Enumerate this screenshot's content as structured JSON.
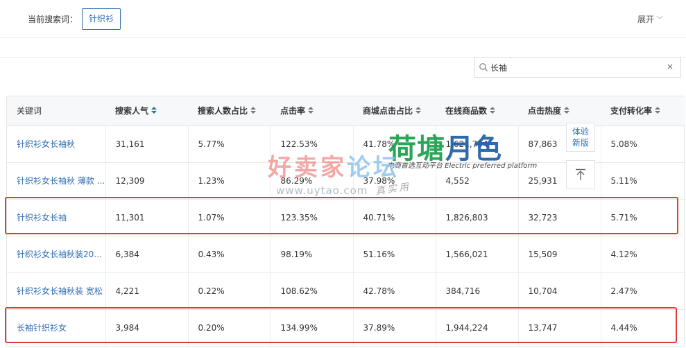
{
  "search": {
    "label": "当前搜索词：",
    "tag": "针织衫",
    "expand_label": "展开"
  },
  "filter": {
    "value": "长袖",
    "clear": "×"
  },
  "table": {
    "headers": [
      "关键词",
      "搜索人气",
      "搜索人数占比",
      "点击率",
      "商城点击占比",
      "在线商品数",
      "点击热度",
      "支付转化率"
    ],
    "sortable": [
      false,
      true,
      true,
      true,
      true,
      true,
      true,
      true
    ],
    "active_sort_index": 1,
    "rows": [
      [
        "针织衫女长袖秋",
        "31,161",
        "5.77%",
        "122.53%",
        "41.78%",
        "1,621,704",
        "87,863",
        "5.08%"
      ],
      [
        "针织衫女长袖秋 薄款 ...",
        "12,309",
        "1.23%",
        "86.29%",
        "37.98%",
        "4,552",
        "25,931",
        "5.11%"
      ],
      [
        "针织衫女长袖",
        "11,301",
        "1.07%",
        "123.35%",
        "40.71%",
        "1,826,803",
        "32,723",
        "5.71%"
      ],
      [
        "针织衫女长袖秋装201...",
        "6,384",
        "0.43%",
        "98.19%",
        "51.16%",
        "1,566,021",
        "15,509",
        "4.12%"
      ],
      [
        "针织衫女长袖秋装 宽松",
        "4,221",
        "0.22%",
        "108.62%",
        "42.78%",
        "384,716",
        "10,704",
        "2.47%"
      ],
      [
        "长袖针织衫女",
        "3,984",
        "0.20%",
        "134.99%",
        "37.89%",
        "1,944,224",
        "13,747",
        "4.44%"
      ]
    ]
  },
  "float_buttons": {
    "try_new_line1": "体验",
    "try_new_line2": "新版"
  },
  "watermark": {
    "logo_text_a": "荷塘",
    "logo_text_b": "月色",
    "logo_sub": "电商首选互动平台 Electric preferred platform",
    "site_name_a": "好卖家",
    "site_name_b": "论坛",
    "site_url": "www.uytao.com",
    "stamp": "真实用"
  },
  "colors": {
    "link_blue": "#2e6cb2",
    "highlight_red": "#e03b36",
    "header_bg": "#f7f8fa"
  }
}
